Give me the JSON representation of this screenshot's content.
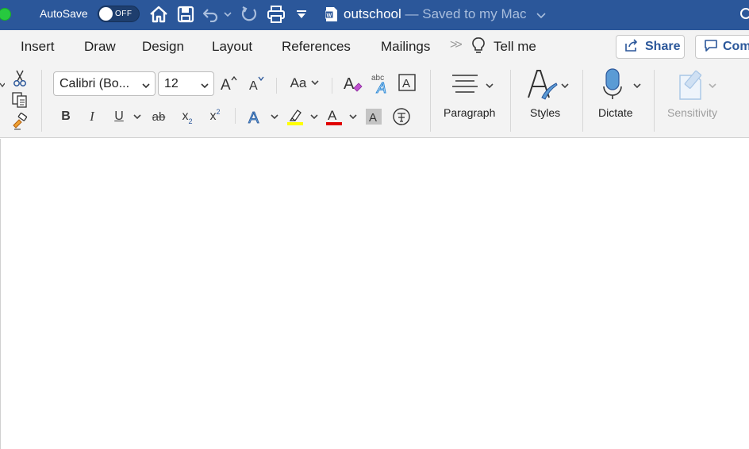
{
  "titlebar": {
    "autosave_label": "AutoSave",
    "autosave_state": "OFF",
    "doc_name": "outschool",
    "doc_status": " — Saved to my Mac",
    "icons": [
      "home-icon",
      "save-icon",
      "undo-icon",
      "redo-icon",
      "print-icon",
      "customize-toolbar-icon",
      "word-doc-icon"
    ]
  },
  "tabs": {
    "items": [
      "Insert",
      "Draw",
      "Design",
      "Layout",
      "References",
      "Mailings"
    ],
    "overflow": ">>",
    "tell_me": "Tell me",
    "share_label": "Share",
    "comments_label": "Com"
  },
  "ribbon": {
    "font_name": "Calibri (Bo...",
    "font_size": "12",
    "change_case": "Aa",
    "bold": "B",
    "italic": "I",
    "underline": "U",
    "strikethrough": "ab",
    "subscript": "x",
    "subscript_mark": "2",
    "superscript": "x",
    "superscript_mark": "2",
    "paragraph_label": "Paragraph",
    "styles_label": "Styles",
    "dictate_label": "Dictate",
    "sensitivity_label": "Sensitivity",
    "highlight_color": "#ffff00",
    "font_color": "#e00000"
  },
  "colors": {
    "titlebar": "#2b579a",
    "ribbon": "#f3f3f3",
    "accent": "#2b579a"
  }
}
